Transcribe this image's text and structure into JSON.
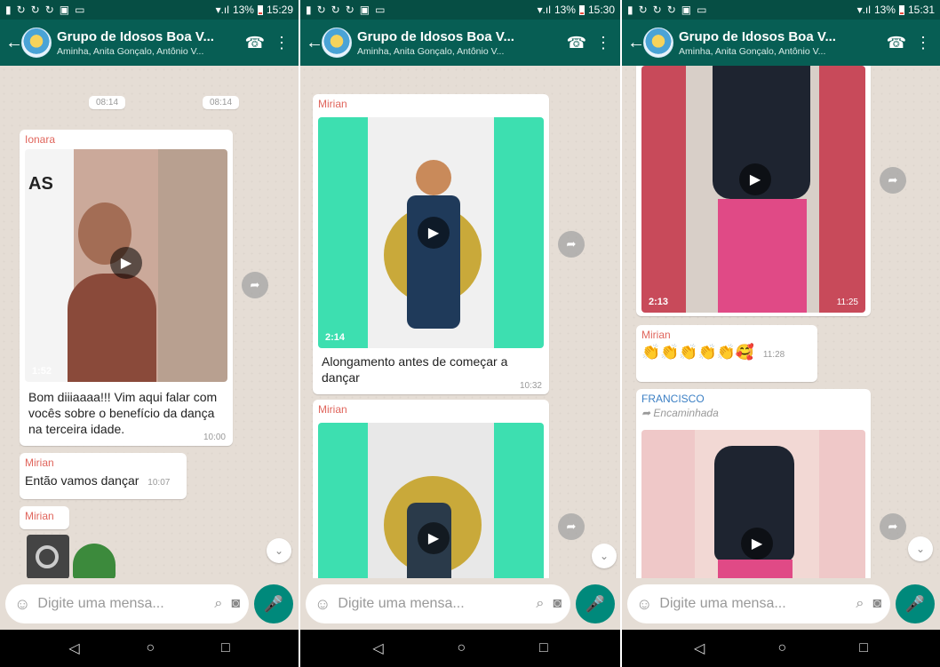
{
  "status": {
    "battery": "13%",
    "times": [
      "15:29",
      "15:30",
      "15:31"
    ]
  },
  "header": {
    "title": "Grupo de Idosos Boa V...",
    "subtitle": "Aminha, Anita Gonçalo, Antônio V..."
  },
  "input": {
    "placeholder": "Digite uma mensa..."
  },
  "icons": {
    "back": "←",
    "call": "☎",
    "menu": "⋮",
    "emoji": "☺",
    "clip": "⌕",
    "camera": "◙",
    "mic": "🎤",
    "play": "▶",
    "share": "➦",
    "scroll": "⌄",
    "nav_back": "◁",
    "nav_home": "○",
    "nav_recent": "□"
  },
  "colors": {
    "header": "#075e54",
    "statusbar": "#064e44",
    "chat_bg": "#e5ddd5",
    "mic": "#00897b",
    "sender_red": "#e0655c",
    "sender_blue": "#3b7fc4"
  },
  "screen1": {
    "top_times": [
      "08:14",
      "08:14"
    ],
    "msg1": {
      "sender": "Ionara",
      "video_len": "1:52",
      "text": "Bom diiiaaaa!!! Vim aqui falar com vocês sobre o benefício da dança na terceira idade.",
      "time": "10:00"
    },
    "msg2": {
      "sender": "Mirian",
      "text": "Então vamos dançar",
      "time": "10:07"
    },
    "msg3": {
      "sender": "Mirian"
    }
  },
  "screen2": {
    "msg1": {
      "sender": "Mirian",
      "video_len": "2:14",
      "text": "Alongamento antes de começar a dançar",
      "time": "10:32"
    },
    "msg2": {
      "sender": "Mirian"
    }
  },
  "screen3": {
    "video1": {
      "len": "2:13",
      "time": "11:25"
    },
    "msg2": {
      "sender": "Mirian",
      "emojis": "👏👏👏👏👏🥰",
      "time": "11:28"
    },
    "msg3": {
      "sender": "FRANCISCO",
      "forwarded": "Encaminhada"
    }
  }
}
